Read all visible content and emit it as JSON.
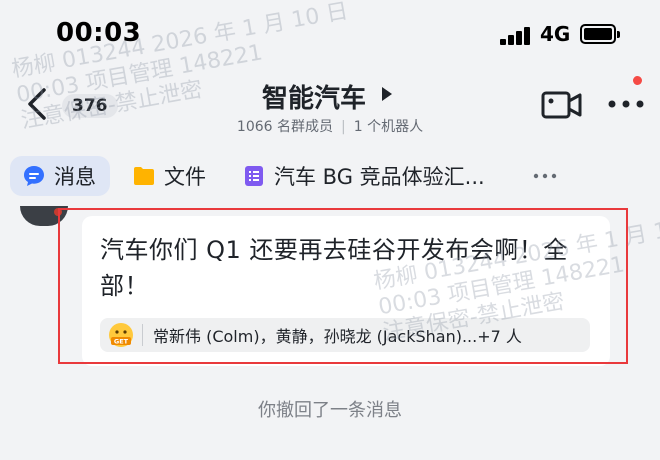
{
  "status_bar": {
    "time": "00:03",
    "network": "4G",
    "battery_level": 1.0
  },
  "header": {
    "unread_count": "376",
    "group_name": "智能汽车",
    "member_count": "1066 名群成员",
    "bot_count": "1 个机器人"
  },
  "tabs": {
    "messages": "消息",
    "files": "文件",
    "doc": "汽车 BG 竞品体验汇..."
  },
  "message": {
    "text": "汽车你们 Q1 还要再去硅谷开发布会啊！全部！",
    "mentions": "常新伟 (Colm)，黄静，孙晓龙 (JackShan)...+7 人",
    "emoji_label": "GET"
  },
  "system": {
    "recall_notice": "你撤回了一条消息"
  },
  "watermark": {
    "line1": "杨柳 013244 2026 年 1 月 10 日",
    "line2": "00:03 项目管理 148221",
    "line3": "注意保密-禁止泄密"
  },
  "colors": {
    "highlight": "#e9393c",
    "active_tab_bg": "#dfe6f5",
    "accent_blue": "#3370ff",
    "folder_yellow": "#ffb300",
    "doc_purple": "#7f5af0"
  }
}
